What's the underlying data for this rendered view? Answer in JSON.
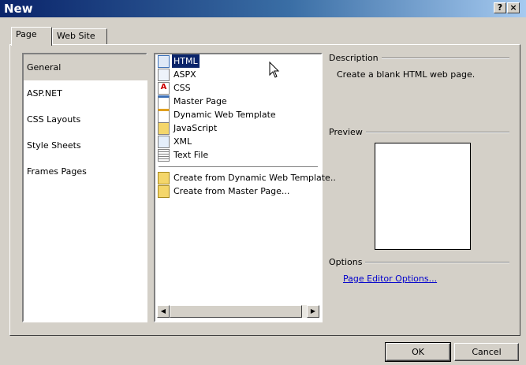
{
  "window": {
    "title": "New",
    "help_label": "?",
    "close_label": "×"
  },
  "tabs": [
    {
      "label": "Page"
    },
    {
      "label": "Web Site"
    }
  ],
  "categories": [
    {
      "label": "General"
    },
    {
      "label": "ASP.NET"
    },
    {
      "label": "CSS Layouts"
    },
    {
      "label": "Style Sheets"
    },
    {
      "label": "Frames Pages"
    }
  ],
  "templates": [
    {
      "label": "HTML",
      "icon": "html-page-icon"
    },
    {
      "label": "ASPX",
      "icon": "aspx-page-icon"
    },
    {
      "label": "CSS",
      "icon": "css-file-icon"
    },
    {
      "label": "Master Page",
      "icon": "master-page-icon"
    },
    {
      "label": "Dynamic Web Template",
      "icon": "dynamic-web-template-icon"
    },
    {
      "label": "JavaScript",
      "icon": "javascript-file-icon"
    },
    {
      "label": "XML",
      "icon": "xml-file-icon"
    },
    {
      "label": "Text File",
      "icon": "text-file-icon"
    }
  ],
  "create_from": [
    {
      "label": "Create from Dynamic Web Template..",
      "icon": "create-from-dwt-icon"
    },
    {
      "label": "Create from Master Page...",
      "icon": "create-from-master-icon"
    }
  ],
  "description": {
    "label": "Description",
    "text": "Create a blank HTML web page."
  },
  "preview": {
    "label": "Preview"
  },
  "options": {
    "label": "Options",
    "link": "Page Editor Options..."
  },
  "buttons": {
    "ok": "OK",
    "cancel": "Cancel"
  },
  "scrollbar": {
    "left_arrow": "◀",
    "right_arrow": "▶"
  }
}
